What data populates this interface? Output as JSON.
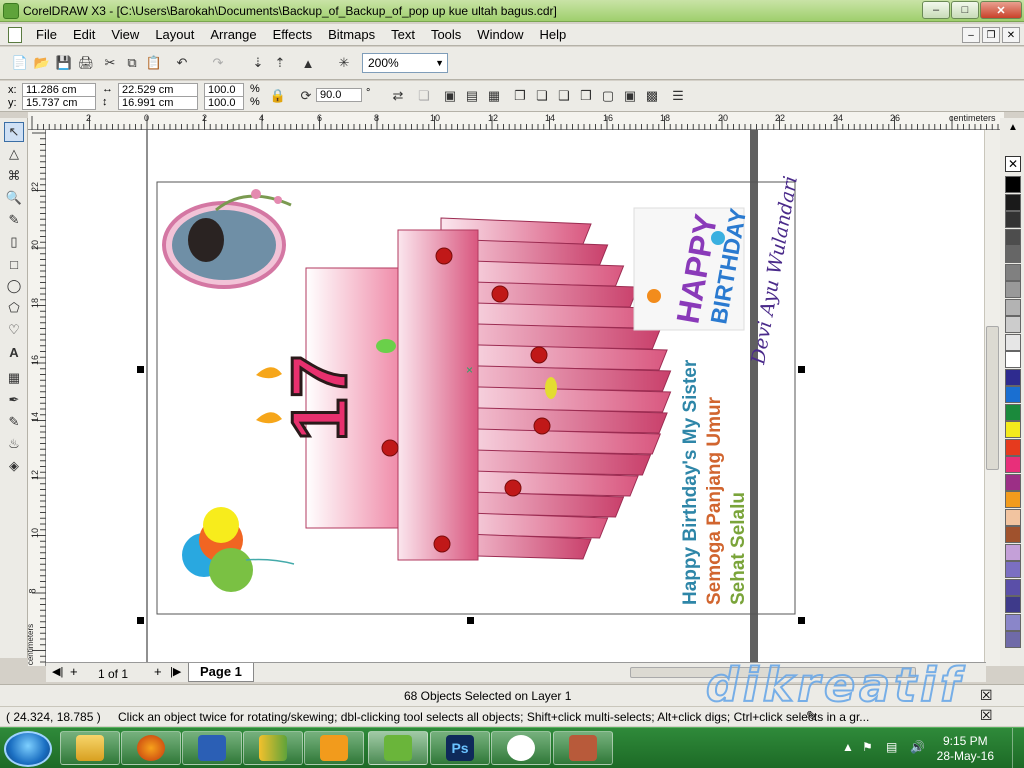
{
  "window": {
    "title": "CorelDRAW X3 - [C:\\Users\\Barokah\\Documents\\Backup_of_Backup_of_pop up kue ultah bagus.cdr]"
  },
  "menu": [
    "File",
    "Edit",
    "View",
    "Layout",
    "Arrange",
    "Effects",
    "Bitmaps",
    "Text",
    "Tools",
    "Window",
    "Help"
  ],
  "toolbar": {
    "zoom": "200%"
  },
  "property_bar": {
    "x": "11.286 cm",
    "y": "15.737 cm",
    "width": "22.529 cm",
    "height": "16.991 cm",
    "scale_x": "100.0",
    "scale_y": "100.0",
    "percent": "%",
    "rotation": "90.0",
    "degree": "°"
  },
  "rulers": {
    "h_ticks": [
      "2",
      "0",
      "2",
      "4",
      "6",
      "8",
      "10",
      "12",
      "14",
      "16",
      "18",
      "20",
      "22",
      "24",
      "26"
    ],
    "h_unit": "centimeters",
    "v_ticks": [
      "22",
      "20",
      "18",
      "16",
      "14",
      "12",
      "10",
      "8"
    ],
    "v_unit": "centimeters"
  },
  "artwork": {
    "number": "17",
    "greeting_lines": [
      "Happy Birthday's My Sister",
      "Semoga Panjang Umur",
      "Sehat Selalu"
    ],
    "name_script": "Devi Ayu Wulandari",
    "sticker_line1": "HAPPY",
    "sticker_line2": "BIRTHDAY"
  },
  "page_nav": {
    "count": "1 of 1",
    "tab": "Page 1"
  },
  "status": {
    "selection": "68 Objects Selected on Layer 1",
    "coords": "( 24.324, 18.785 )",
    "hint": "Click an object twice for rotating/skewing; dbl-clicking tool selects all objects; Shift+click multi-selects; Alt+click digs; Ctrl+click selects in a gr..."
  },
  "taskbar": {
    "time": "9:15 PM",
    "date": "28-May-16",
    "ps_label": "Ps"
  },
  "watermark": "dikreatif",
  "palette_colors": [
    "#ffffff",
    "#000000",
    "#1a1a1a",
    "#333333",
    "#4d4d4d",
    "#666666",
    "#808080",
    "#999999",
    "#b3b3b3",
    "#cccccc",
    "#e6e6e6",
    "#ffffff",
    "#2e2b8f",
    "#1a6fd1",
    "#1b8a3c",
    "#f4ea1c",
    "#e63a1e",
    "#e82f7a",
    "#9c2f86",
    "#f29b1c",
    "#f2c4a0",
    "#a0522d",
    "#c4a0d8",
    "#7b6fc2",
    "#5a4fa8",
    "#3e3a8a",
    "#8a86c9",
    "#6f6aa8"
  ]
}
